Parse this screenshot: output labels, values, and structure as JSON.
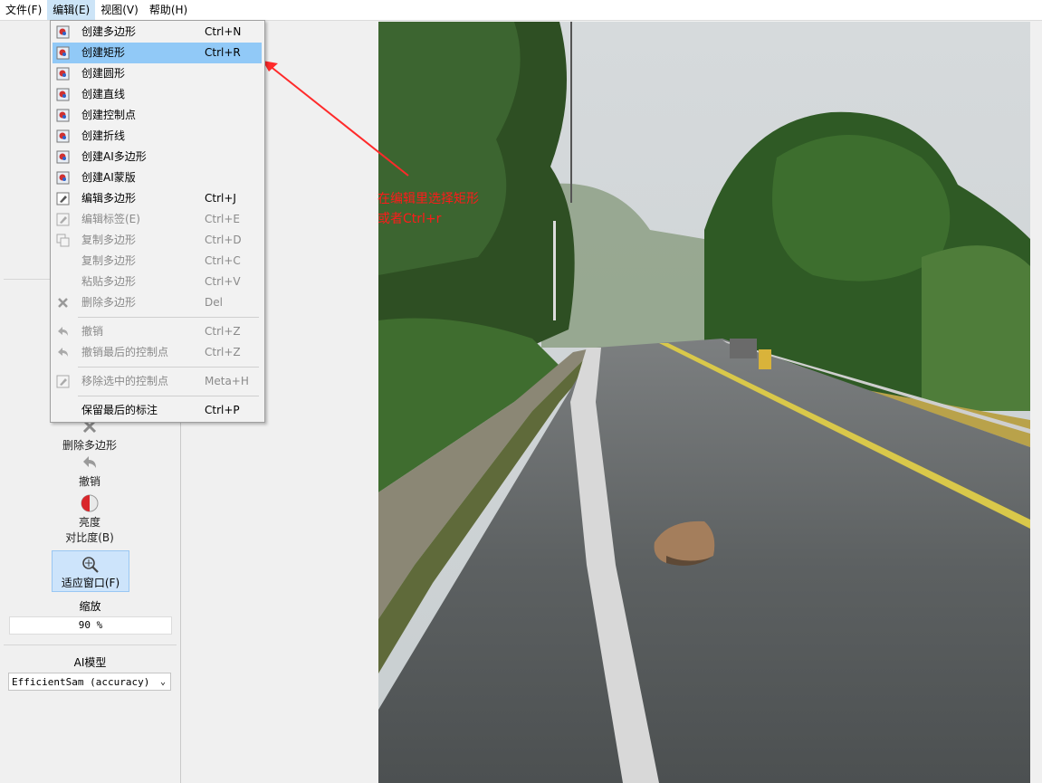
{
  "menubar": {
    "items": [
      {
        "label": "文件(F)"
      },
      {
        "label": "编辑(E)"
      },
      {
        "label": "视图(V)"
      },
      {
        "label": "帮助(H)"
      }
    ]
  },
  "edit_menu": {
    "items": [
      {
        "label": "创建多边形",
        "shortcut": "Ctrl+N",
        "icon": "create-polygon-icon",
        "disabled": false
      },
      {
        "label": "创建矩形",
        "shortcut": "Ctrl+R",
        "icon": "create-rectangle-icon",
        "disabled": false,
        "highlighted": true
      },
      {
        "label": "创建圆形",
        "shortcut": "",
        "icon": "create-circle-icon",
        "disabled": false
      },
      {
        "label": "创建直线",
        "shortcut": "",
        "icon": "create-line-icon",
        "disabled": false
      },
      {
        "label": "创建控制点",
        "shortcut": "",
        "icon": "create-point-icon",
        "disabled": false
      },
      {
        "label": "创建折线",
        "shortcut": "",
        "icon": "create-linestrip-icon",
        "disabled": false
      },
      {
        "label": "创建AI多边形",
        "shortcut": "",
        "icon": "create-ai-polygon-icon",
        "disabled": false
      },
      {
        "label": "创建AI蒙版",
        "shortcut": "",
        "icon": "create-ai-mask-icon",
        "disabled": false
      },
      {
        "label": "编辑多边形",
        "shortcut": "Ctrl+J",
        "icon": "edit-polygon-icon",
        "disabled": false
      },
      {
        "label": "编辑标签(E)",
        "shortcut": "Ctrl+E",
        "icon": "edit-label-icon",
        "disabled": true
      },
      {
        "label": "复制多边形",
        "shortcut": "Ctrl+D",
        "icon": "duplicate-icon",
        "disabled": true
      },
      {
        "label": "复制多边形",
        "shortcut": "Ctrl+C",
        "icon": "",
        "disabled": true
      },
      {
        "label": "粘贴多边形",
        "shortcut": "Ctrl+V",
        "icon": "",
        "disabled": true
      },
      {
        "label": "删除多边形",
        "shortcut": "Del",
        "icon": "delete-icon",
        "disabled": true
      },
      {
        "label": "撤销",
        "shortcut": "Ctrl+Z",
        "icon": "undo-icon",
        "disabled": true
      },
      {
        "label": "撤销最后的控制点",
        "shortcut": "Ctrl+Z",
        "icon": "undo-icon",
        "disabled": true
      },
      {
        "label": "移除选中的控制点",
        "shortcut": "Meta+H",
        "icon": "edit-icon",
        "disabled": true
      },
      {
        "label": "保留最后的标注",
        "shortcut": "Ctrl+P",
        "icon": "",
        "disabled": false
      }
    ]
  },
  "sidebar": {
    "delete_polygon": "删除多边形",
    "undo": "撤销",
    "brightness": "亮度",
    "contrast": "对比度(B)",
    "fit_window": "适应窗口(F)",
    "zoom_label": "缩放",
    "zoom_value": "90 %",
    "ai_model_label": "AI模型",
    "ai_model_value": "EfficientSam (accuracy)"
  },
  "annotation": {
    "line1": "在编辑里选择矩形",
    "line2": "或者Ctrl+r",
    "color": "#ff1a1a"
  },
  "colors": {
    "highlight": "#91c9f7",
    "fit_button": "#cde4fb"
  }
}
